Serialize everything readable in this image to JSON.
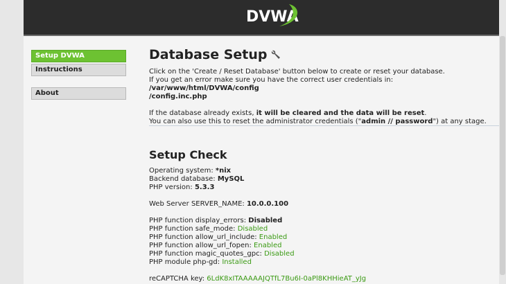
{
  "header": {
    "logo_text": "DVWA"
  },
  "menu": {
    "items": [
      {
        "label": "Setup DVWA"
      },
      {
        "label": "Instructions"
      },
      {
        "label": "About"
      }
    ]
  },
  "main": {
    "title": "Database Setup",
    "intro": {
      "line1": "Click on the 'Create / Reset Database' button below to create or reset your database.",
      "line2_prefix": "If you get an error make sure you have the correct user credentials in: ",
      "config_path_a": "/var/www/html/DVWA/config",
      "config_path_b": "/config.inc.php",
      "line3_prefix": "If the database already exists, ",
      "line3_bold": "it will be cleared and the data will be reset",
      "line3_suffix": ".",
      "line4_prefix": "You can also use this to reset the administrator credentials (\"",
      "line4_bold": "admin // password",
      "line4_suffix": "\") at any stage."
    },
    "check_title": "Setup Check",
    "system": [
      {
        "label": "Operating system: ",
        "value": "*nix"
      },
      {
        "label": "Backend database: ",
        "value": "MySQL"
      },
      {
        "label": "PHP version: ",
        "value": "5.3.3"
      }
    ],
    "server_name": {
      "label": "Web Server SERVER_NAME: ",
      "value": "10.0.0.100"
    },
    "php_functions": [
      {
        "label": "PHP function display_errors: ",
        "value": "Disabled"
      },
      {
        "label": "PHP function safe_mode: ",
        "value": "Disabled"
      },
      {
        "label": "PHP function allow_url_include: ",
        "value": "Enabled"
      },
      {
        "label": "PHP function allow_url_fopen: ",
        "value": "Enabled"
      },
      {
        "label": "PHP function magic_quotes_gpc: ",
        "value": "Disabled"
      },
      {
        "label": "PHP module php-gd: ",
        "value": "Installed"
      }
    ],
    "recaptcha": {
      "label": "reCAPTCHA key: ",
      "value": "6LdK8xITAAAAAJQTfL7Bu6I-0aPl8KHHieAT_yJg"
    }
  },
  "colors": {
    "accent": "#6dc232",
    "ok": "#3a9a13",
    "header_bg": "#2c2c2c"
  }
}
